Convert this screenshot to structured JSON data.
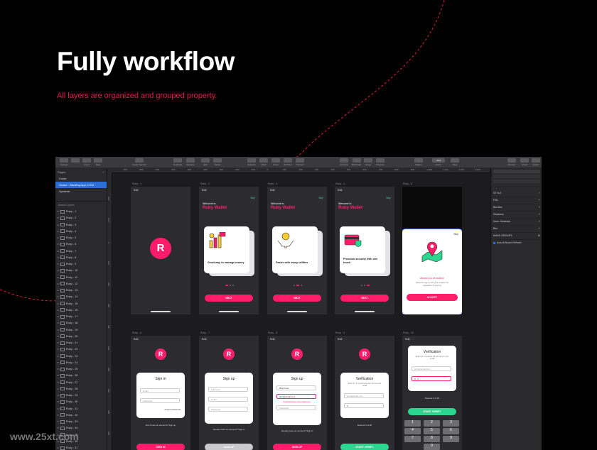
{
  "header": {
    "title": "Fully workflow",
    "subtitle": "All layers are  organized and grouped property."
  },
  "watermark": "www.25xt.com",
  "colors": {
    "accent": "#ff1d6a",
    "subtitle": "#e21d4d",
    "success": "#2bd68e",
    "selection": "#2b6fd6"
  },
  "toolbar": {
    "left": [
      "Canvas",
      "Insert",
      "Data"
    ],
    "center_left": [
      "Create Symbol",
      "Duplicate",
      "Rename",
      "Edit",
      "Vector",
      "Scissors",
      "Mask",
      "Union",
      "Subtract",
      "Intersect"
    ],
    "center": [
      "Forward",
      "Backward",
      "Group",
      "Ungroup",
      "Rotate"
    ],
    "right": [
      "Flatten",
      "Zoom",
      "View",
      "Preview",
      "Cloud",
      "Export"
    ],
    "zoom": "31%"
  },
  "pages": {
    "header": "Pages",
    "items": [
      "Cover",
      "Onace - Banking App UI Kit",
      "Symbols"
    ],
    "selected_index": 1
  },
  "layers": {
    "search_placeholder": "Search Layers",
    "items": [
      "Ruby - 1",
      "Ruby - 2",
      "Ruby - 3",
      "Ruby - 4",
      "Ruby - 5",
      "Ruby - 6",
      "Ruby - 7",
      "Ruby - 8",
      "Ruby - 9",
      "Ruby - 10",
      "Ruby - 11",
      "Ruby - 12",
      "Ruby - 13",
      "Ruby - 14",
      "Ruby - 15",
      "Ruby - 16",
      "Ruby - 17",
      "Ruby - 18",
      "Ruby - 19",
      "Ruby - 20",
      "Ruby - 21",
      "Ruby - 22",
      "Ruby - 23",
      "Ruby - 24",
      "Ruby - 25",
      "Ruby - 26",
      "Ruby - 27",
      "Ruby - 28",
      "Ruby - 29",
      "Ruby - 30",
      "Ruby - 31",
      "Ruby - 32",
      "Ruby - 33",
      "Ruby - 34",
      "Ruby - 35",
      "Ruby - 36",
      "Ruby - 37"
    ]
  },
  "ruler": {
    "x": [
      "-900",
      "-800",
      "-700",
      "-600",
      "-500",
      "-400",
      "-300",
      "-200",
      "-100",
      "0",
      "100",
      "200",
      "300",
      "400",
      "500",
      "600",
      "700",
      "800",
      "900",
      "1,000",
      "1,100",
      "1,200",
      "1,300"
    ],
    "y": [
      "-200",
      "-100",
      "0",
      "100",
      "200",
      "300",
      "400",
      "500",
      "600",
      "700",
      "800",
      "900"
    ]
  },
  "inspector": {
    "sections": [
      "STYLE",
      "Fills",
      "Borders",
      "Shadows",
      "Inner Shadows",
      "Blur"
    ],
    "option_label": "MAKE GROUPS",
    "checkbox_label": "Auto-fit Board Refresh"
  },
  "artboards": [
    {
      "label": "Ruby - 1",
      "time": "9:41",
      "logo": "R"
    },
    {
      "label": "Ruby - 2",
      "time": "9:41",
      "skip": "Skip",
      "welcome": "Welcome to",
      "brand": "Ruby Wallet",
      "card": "Great way to manage money",
      "button": "NEXT"
    },
    {
      "label": "Ruby - 3",
      "time": "9:41",
      "skip": "Skip",
      "welcome": "Welcome to",
      "brand": "Ruby Wallet",
      "card": "Faster with many utilities",
      "button": "NEXT"
    },
    {
      "label": "Ruby - 4",
      "time": "9:41",
      "skip": "Skip",
      "welcome": "Welcome to",
      "brand": "Ruby Wallet",
      "card": "Premium security with one touch",
      "button": "NEXT"
    },
    {
      "label": "Ruby - 5",
      "skip": "Skip",
      "card_title": "Allows you of location",
      "card_body": "Allow the app to use your location for navigation & security",
      "button": "ACCEPT"
    },
    {
      "label": "Ruby - 6",
      "time": "9:41",
      "logo": "R",
      "form_title": "Sign in",
      "fields": [
        "Email",
        "Password"
      ],
      "forgot": "Forgot password?",
      "footer": "Don't have an account? Sign up",
      "button": "SIGN IN"
    },
    {
      "label": "Ruby - 7",
      "time": "9:41",
      "logo": "R",
      "form_title": "Sign up",
      "fields": [
        "Full name",
        "Email",
        "Password"
      ],
      "footer": "Already have an account? Sign in",
      "button": "SIGN UP"
    },
    {
      "label": "Ruby - 8",
      "time": "9:41",
      "logo": "R",
      "form_title": "Sign up",
      "fields": [
        "Brad Cole",
        "john@email.com",
        "Password"
      ],
      "error": "Email already used please use",
      "footer": "Already have an account? Sign in",
      "button": "SIGN UP"
    },
    {
      "label": "Ruby - 9",
      "time": "9:41",
      "logo": "R",
      "form_title": "Verification",
      "body": "Enter the 6 numbers we just sent to your email",
      "fields": [
        "john@email.com",
        "0"
      ],
      "footer": "Resend in 0:36",
      "button": "START VERIFY"
    },
    {
      "label": "Ruby - 10",
      "time": "9:41",
      "form_title": "Verification",
      "body": "Enter the 6 numbers we just sent to your email",
      "fields": [
        "john@email.com",
        "0 - 1"
      ],
      "footer": "Resend in 0:36",
      "button": "START VERIFY",
      "keys": [
        "1",
        "2",
        "3",
        "4",
        "5",
        "6",
        "7",
        "8",
        "9",
        "0"
      ]
    }
  ]
}
